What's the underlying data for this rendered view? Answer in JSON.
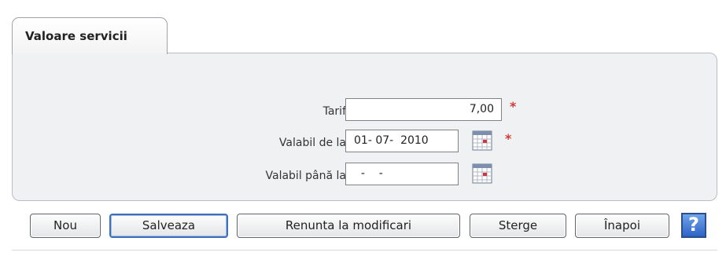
{
  "tab": {
    "label": "Valoare servicii"
  },
  "form": {
    "tarif": {
      "label": "Tarif",
      "value": "7,00",
      "required": "*"
    },
    "valabil_de_la": {
      "label": "Valabil de la",
      "value": "01- 07-  2010",
      "required": "*"
    },
    "valabil_pana_la": {
      "label": "Valabil până la",
      "value": "  -    -"
    }
  },
  "icons": {
    "calendar": "calendar-icon",
    "help": "help-icon"
  },
  "buttons": {
    "nou": "Nou",
    "salveaza": "Salveaza",
    "renunta": "Renunta la modificari",
    "sterge": "Sterge",
    "inapoi": "Înapoi",
    "help": "?"
  },
  "colors": {
    "required": "#d23a3a",
    "panel_bg": "#f0f1f3",
    "focus_border": "#3e6fb8",
    "help_bg": "#2d63c6"
  }
}
